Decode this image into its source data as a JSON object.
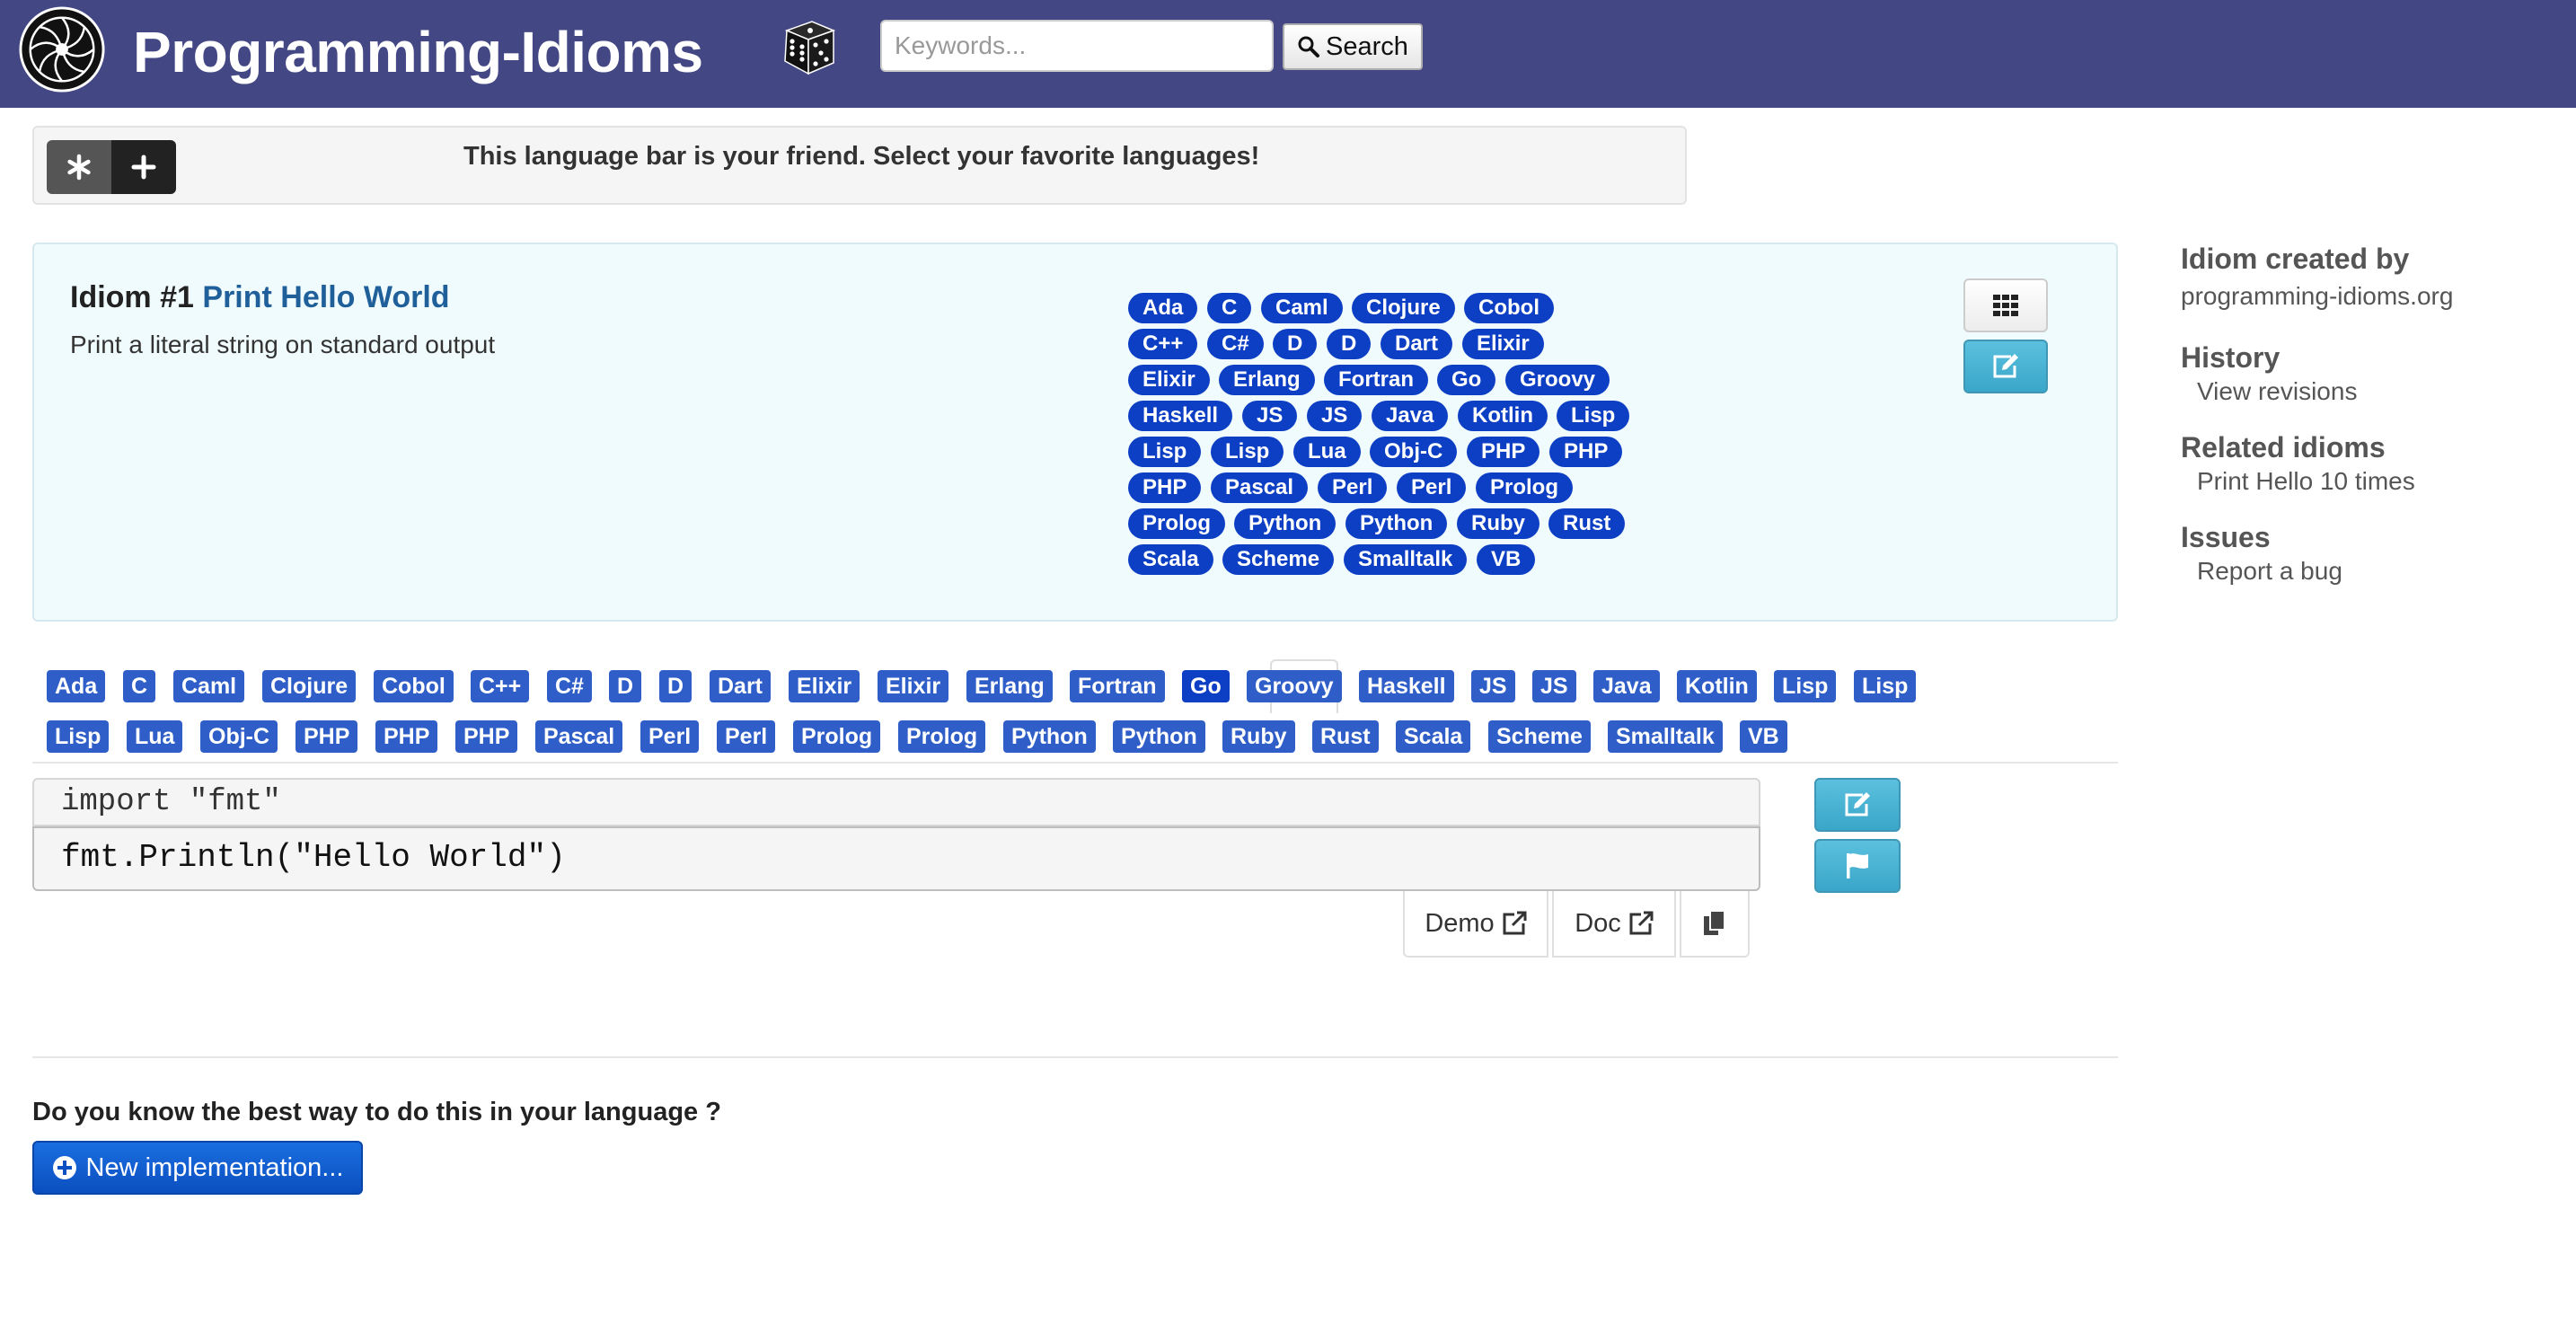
{
  "header": {
    "brand": "Programming-Idioms",
    "search_placeholder": "Keywords...",
    "search_label": "Search"
  },
  "language_bar": {
    "message": "This language bar is your friend. Select your favorite languages!"
  },
  "idiom": {
    "number_label": "Idiom #1",
    "title": "Print Hello World",
    "lead": "Print a literal string on standard output",
    "implementation_languages": [
      "Ada",
      "C",
      "Caml",
      "Clojure",
      "Cobol",
      "C++",
      "C#",
      "D",
      "D",
      "Dart",
      "Elixir",
      "Elixir",
      "Erlang",
      "Fortran",
      "Go",
      "Groovy",
      "Haskell",
      "JS",
      "JS",
      "Java",
      "Kotlin",
      "Lisp",
      "Lisp",
      "Lisp",
      "Lua",
      "Obj-C",
      "PHP",
      "PHP",
      "PHP",
      "Pascal",
      "Perl",
      "Perl",
      "Prolog",
      "Prolog",
      "Python",
      "Python",
      "Ruby",
      "Rust",
      "Scala",
      "Scheme",
      "Smalltalk",
      "VB"
    ]
  },
  "side": {
    "created_heading": "Idiom created by",
    "created_by": "programming-idioms.org",
    "history_heading": "History",
    "history_link": "View revisions",
    "related_heading": "Related idioms",
    "related_link": "Print Hello 10 times",
    "issues_heading": "Issues",
    "issues_link": "Report a bug"
  },
  "tabs": {
    "row1": [
      "Ada",
      "C",
      "Caml",
      "Clojure",
      "Cobol",
      "C++",
      "C#",
      "D",
      "D",
      "Dart",
      "Elixir",
      "Elixir",
      "Erlang",
      "Fortran",
      "Go",
      "Groovy",
      "Haskell",
      "JS",
      "JS",
      "Java",
      "Kotlin",
      "Lisp",
      "Lisp"
    ],
    "row2": [
      "Lisp",
      "Lua",
      "Obj-C",
      "PHP",
      "PHP",
      "PHP",
      "Pascal",
      "Perl",
      "Perl",
      "Prolog",
      "Prolog",
      "Python",
      "Python",
      "Ruby",
      "Rust",
      "Scala",
      "Scheme",
      "Smalltalk",
      "VB"
    ],
    "active": "Go"
  },
  "implementation": {
    "import_line": "import \"fmt\"",
    "code": "fmt.Println(\"Hello World\")",
    "demo_label": "Demo",
    "doc_label": "Doc"
  },
  "footer": {
    "prompt": "Do you know the best way to do this in your language ?",
    "new_button": "New implementation..."
  },
  "colors": {
    "navbar": "#434784",
    "pill": "#0d3fc4",
    "tag": "#2f5ec8",
    "info_button": "#5bc0de",
    "primary_button": "#0b4fc0",
    "summary_bg": "#f0fbfd"
  },
  "icons": [
    "logo-icon",
    "dice-icon",
    "search-icon",
    "asterisk-icon",
    "plus-icon",
    "grid-icon",
    "edit-icon",
    "flag-icon",
    "external-link-icon",
    "copy-icon",
    "plus-circle-icon"
  ]
}
